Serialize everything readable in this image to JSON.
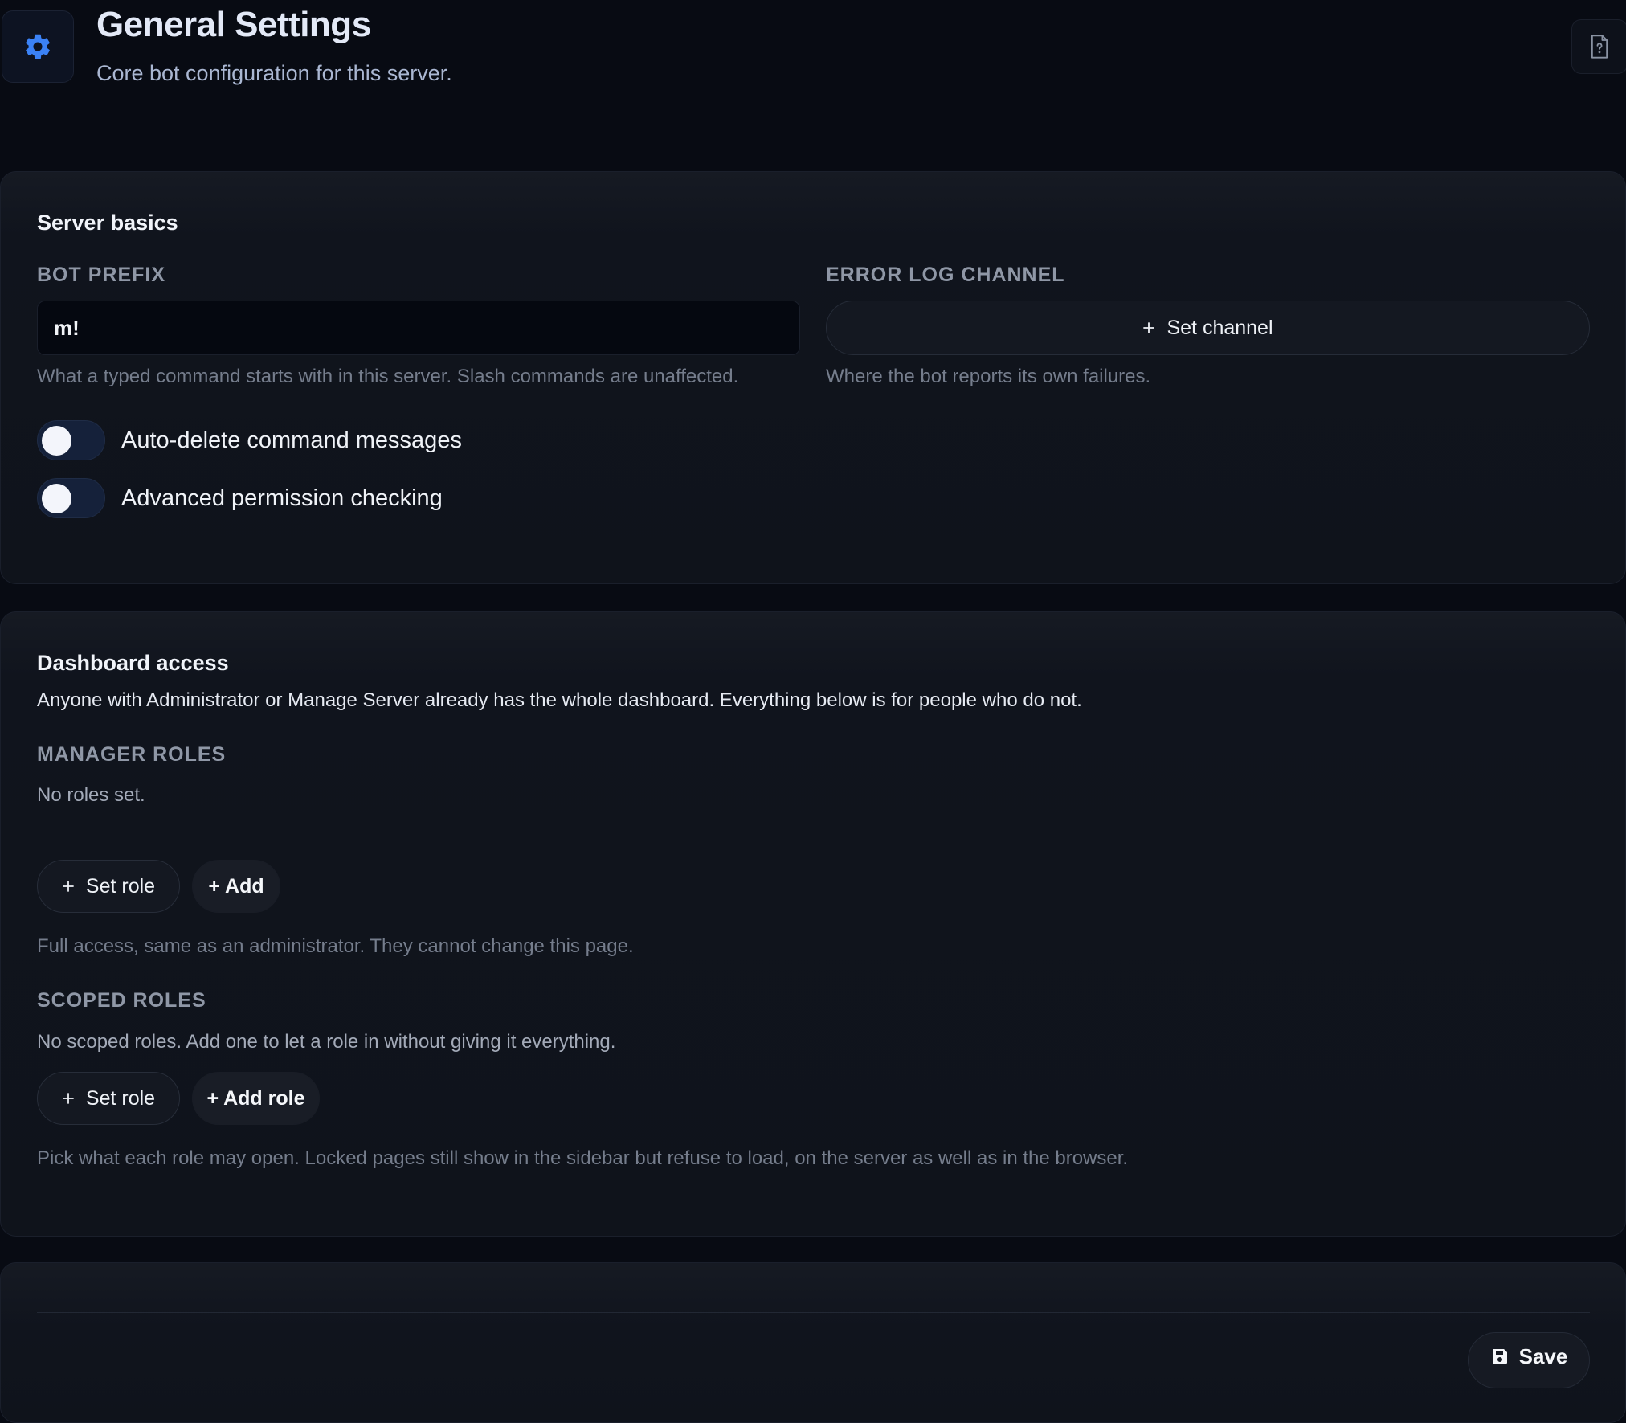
{
  "header": {
    "icon": "gear-icon",
    "title": "General Settings",
    "subtitle": "Core bot configuration for this server.",
    "help_icon": "help-document-icon",
    "accent_color": "#3b82f6"
  },
  "server_basics": {
    "title": "Server basics",
    "bot_prefix": {
      "label": "BOT PREFIX",
      "value": "m!",
      "help": "What a typed command starts with in this server. Slash commands are unaffected."
    },
    "error_log_channel": {
      "label": "ERROR LOG CHANNEL",
      "button_icon": "plus-icon",
      "button_label": "Set channel",
      "help": "Where the bot reports its own failures."
    },
    "toggles": [
      {
        "label": "Auto-delete command messages",
        "on": false
      },
      {
        "label": "Advanced permission checking",
        "on": false
      }
    ]
  },
  "dashboard_access": {
    "title": "Dashboard access",
    "description": "Anyone with Administrator or Manage Server already has the whole dashboard. Everything below is for people who do not.",
    "manager_roles": {
      "label": "MANAGER ROLES",
      "empty": "No roles set.",
      "set_role_label": "Set role",
      "add_label": "+ Add",
      "help": "Full access, same as an administrator. They cannot change this page."
    },
    "scoped_roles": {
      "label": "SCOPED ROLES",
      "empty": "No scoped roles. Add one to let a role in without giving it everything.",
      "set_role_label": "Set role",
      "add_label": "+ Add role",
      "help": "Pick what each role may open. Locked pages still show in the sidebar but refuse to load, on the server as well as in the browser."
    }
  },
  "footer": {
    "save_icon": "floppy-disk-icon",
    "save_label": "Save"
  }
}
